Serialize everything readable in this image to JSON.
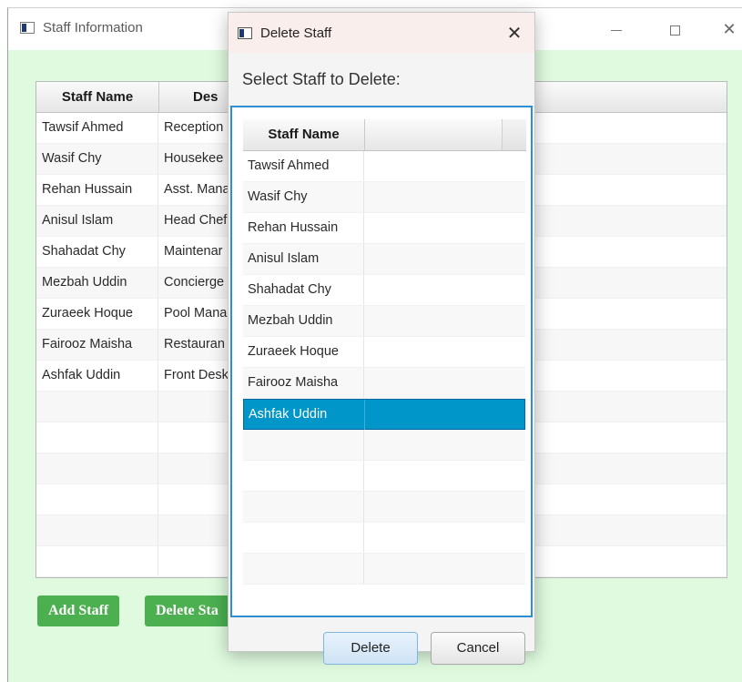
{
  "main_window": {
    "title": "Staff Information",
    "columns": [
      "Staff Name",
      "Des"
    ],
    "rows": [
      {
        "name": "Tawsif Ahmed",
        "designation": "Reception"
      },
      {
        "name": "Wasif Chy",
        "designation": "Housekee"
      },
      {
        "name": "Rehan Hussain",
        "designation": "Asst. Mana"
      },
      {
        "name": "Anisul Islam",
        "designation": "Head Chef"
      },
      {
        "name": "Shahadat Chy",
        "designation": "Maintenar"
      },
      {
        "name": "Mezbah Uddin",
        "designation": "Concierge"
      },
      {
        "name": "Zuraeek Hoque",
        "designation": "Pool Mana"
      },
      {
        "name": "Fairooz Maisha",
        "designation": "Restauran"
      },
      {
        "name": "Ashfak Uddin",
        "designation": "Front Desk"
      }
    ],
    "add_button": "Add Staff",
    "delete_button": "Delete Sta"
  },
  "dialog": {
    "title": "Delete Staff",
    "close_glyph": "✕",
    "header": "Select Staff to Delete:",
    "column": "Staff Name",
    "staff": [
      "Tawsif Ahmed",
      "Wasif Chy",
      "Rehan Hussain",
      "Anisul Islam",
      "Shahadat Chy",
      "Mezbah Uddin",
      "Zuraeek Hoque",
      "Fairooz Maisha",
      "Ashfak Uddin"
    ],
    "selected": "Ashfak Uddin",
    "delete_button": "Delete",
    "cancel_button": "Cancel"
  },
  "colors": {
    "content_bg": "#dffadf",
    "green_button": "#4caf50",
    "selection": "#0096c9",
    "focus_border": "#2d8fd1"
  }
}
